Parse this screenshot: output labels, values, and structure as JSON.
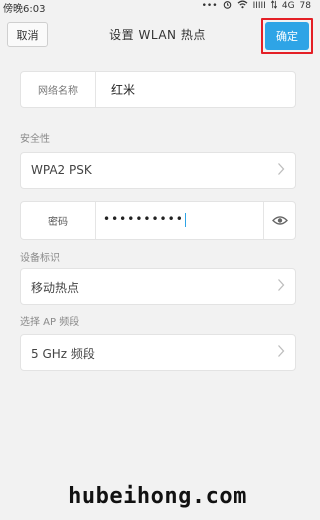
{
  "status": {
    "time": "傍晚6:03",
    "signal": "IIIII",
    "network": "4G",
    "battery": "78",
    "dots": "•••"
  },
  "header": {
    "cancel_label": "取消",
    "title": "设置 WLAN 热点",
    "confirm_label": "确定"
  },
  "network_name": {
    "label": "网络名称",
    "value": "红米"
  },
  "security": {
    "section_label": "安全性",
    "value": "WPA2 PSK"
  },
  "password": {
    "label": "密码",
    "value": "••••••••••"
  },
  "device_id": {
    "section_label": "设备标识",
    "value": "移动热点"
  },
  "band": {
    "section_label": "选择 AP 频段",
    "value": "5 GHz 频段"
  },
  "watermark": "hubeihong.com"
}
